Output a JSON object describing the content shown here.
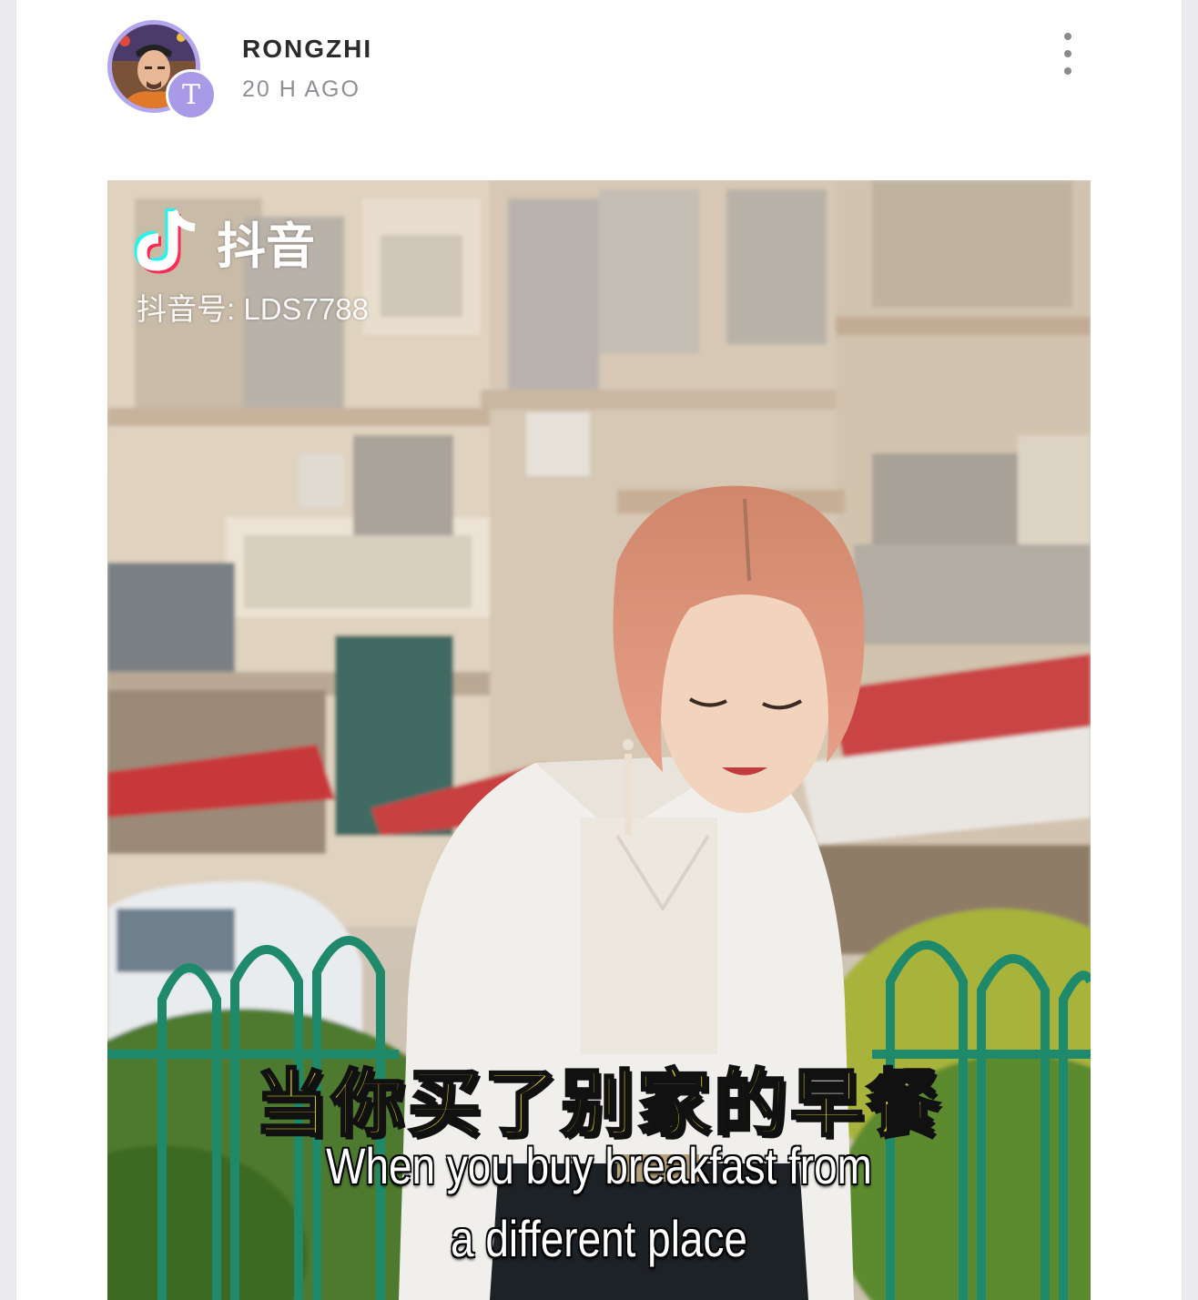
{
  "post": {
    "author": {
      "name": "RONGZHI",
      "badge_letter": "T",
      "avatar_ring_color": "#b3a6ef",
      "badge_color": "#a89ae6"
    },
    "time_ago": "20 H AGO",
    "menu_icon": "more-vertical-icon"
  },
  "media": {
    "type": "video-still",
    "watermark": {
      "logo_icon": "douyin-logo-icon",
      "app_name": "抖音",
      "account_id": "抖音号: LDS7788"
    },
    "subtitle_cn": "当你买了别家的早餐",
    "subtitle_en_line1": "When you buy breakfast from",
    "subtitle_en_line2": "a different place",
    "colors": {
      "subtitle_cn": "#ffee1a",
      "subtitle_en": "#ffffff",
      "railing": "#1f8a6b",
      "awning": "#c7383a"
    }
  }
}
